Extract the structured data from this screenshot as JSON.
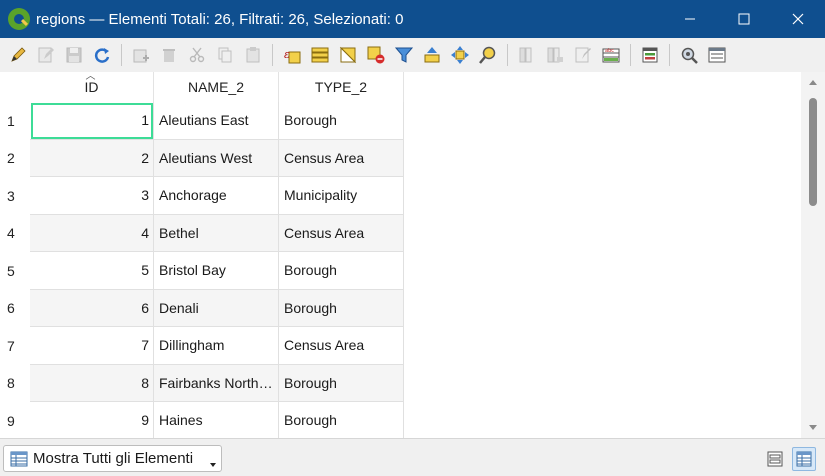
{
  "window": {
    "title": "regions — Elementi Totali: 26,  Filtrati: 26, Selezionati: 0",
    "icon": "qgis-logo-icon"
  },
  "toolbar": {
    "buttons": [
      {
        "name": "toggle-editing-icon",
        "enabled": true
      },
      {
        "name": "toggle-multi-edit-icon",
        "enabled": false
      },
      {
        "name": "save-edits-icon",
        "enabled": false
      },
      {
        "name": "reload-table-icon",
        "enabled": true
      },
      {
        "name": "add-feature-icon",
        "enabled": false
      },
      {
        "name": "delete-selected-icon",
        "enabled": false
      },
      {
        "name": "cut-selected-icon",
        "enabled": false
      },
      {
        "name": "copy-selected-icon",
        "enabled": false
      },
      {
        "name": "paste-features-icon",
        "enabled": false
      },
      {
        "name": "select-by-expression-icon",
        "enabled": true
      },
      {
        "name": "select-all-icon",
        "enabled": true
      },
      {
        "name": "invert-selection-icon",
        "enabled": true
      },
      {
        "name": "deselect-all-icon",
        "enabled": true
      },
      {
        "name": "filter-select-icon",
        "enabled": true
      },
      {
        "name": "move-selection-top-icon",
        "enabled": true
      },
      {
        "name": "pan-to-selection-icon",
        "enabled": true
      },
      {
        "name": "zoom-to-selection-icon",
        "enabled": true
      },
      {
        "name": "new-field-icon",
        "enabled": false
      },
      {
        "name": "delete-field-icon",
        "enabled": false
      },
      {
        "name": "field-calculator-icon",
        "enabled": false
      },
      {
        "name": "conditional-formatting-icon",
        "enabled": true
      },
      {
        "name": "organize-columns-icon",
        "enabled": true
      },
      {
        "name": "actions-icon",
        "enabled": true
      },
      {
        "name": "dock-window-icon",
        "enabled": true
      }
    ]
  },
  "table": {
    "columns": [
      "ID",
      "NAME_2",
      "TYPE_2"
    ],
    "rows": [
      {
        "row": "1",
        "id": "1",
        "name": "Aleutians East",
        "type": "Borough"
      },
      {
        "row": "2",
        "id": "2",
        "name": "Aleutians West",
        "type": "Census Area"
      },
      {
        "row": "3",
        "id": "3",
        "name": "Anchorage",
        "type": "Municipality"
      },
      {
        "row": "4",
        "id": "4",
        "name": "Bethel",
        "type": "Census Area"
      },
      {
        "row": "5",
        "id": "5",
        "name": "Bristol Bay",
        "type": "Borough"
      },
      {
        "row": "6",
        "id": "6",
        "name": "Denali",
        "type": "Borough"
      },
      {
        "row": "7",
        "id": "7",
        "name": "Dillingham",
        "type": "Census Area"
      },
      {
        "row": "8",
        "id": "8",
        "name": "Fairbanks North…",
        "type": "Borough"
      },
      {
        "row": "9",
        "id": "9",
        "name": "Haines",
        "type": "Borough"
      }
    ]
  },
  "bottom": {
    "filter_label": "Mostra Tutti gli Elementi",
    "view_form_icon": "form-view-icon",
    "view_table_icon": "table-view-icon"
  },
  "colors": {
    "titlebar": "#0f4f8f",
    "selection_outline": "#3ddc97"
  }
}
